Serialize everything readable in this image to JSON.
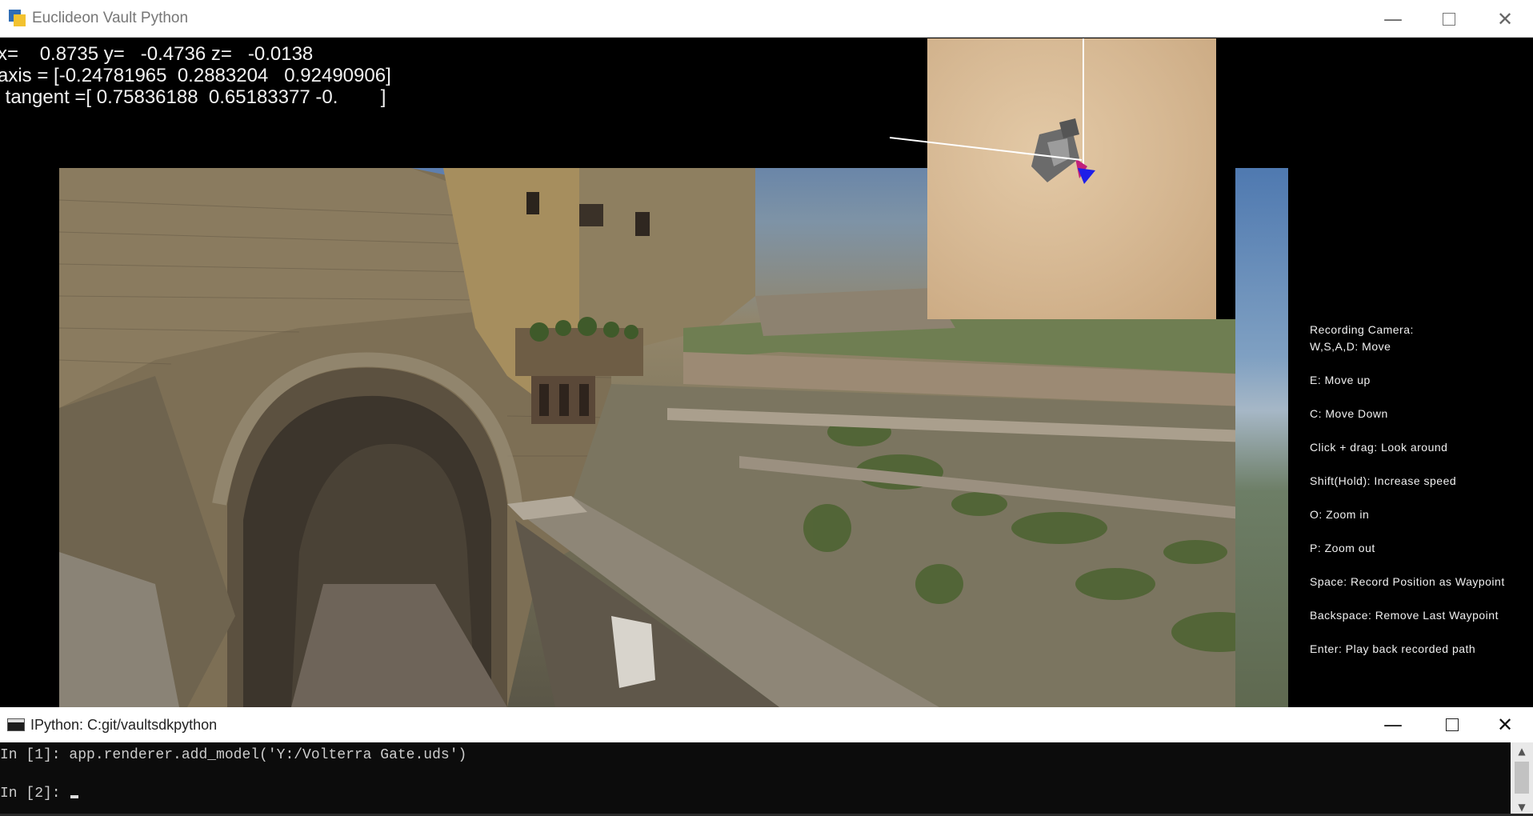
{
  "viewer": {
    "title": "Euclideon Vault Python",
    "readout": {
      "position": "x=    0.8735 y=   -0.4736 z=   -0.0138",
      "axis": "axis = [-0.24781965  0.2883204   0.92490906]",
      "tangent": " tangent =[ 0.75836188  0.65183377 -0.        ]"
    },
    "help": [
      "Recording Camera:",
      "W,S,A,D: Move",
      "E: Move up",
      "C: Move Down",
      "Click + drag: Look around",
      "Shift(Hold): Increase speed",
      "O: Zoom in",
      "P: Zoom out",
      "Space: Record Position as Waypoint",
      "Backspace: Remove Last Waypoint",
      "Enter: Play back recorded path"
    ]
  },
  "console": {
    "title": "IPython: C:git/vaultsdkpython",
    "lines": [
      "In [1]: app.renderer.add_model('Y:/Volterra Gate.uds')",
      "In [2]: "
    ]
  },
  "colors": {
    "minimap_sand": "#d6b893",
    "gizmo_blue": "#1e1ee8",
    "gizmo_magenta": "#c0207a",
    "console_bg": "#0c0c0c"
  }
}
